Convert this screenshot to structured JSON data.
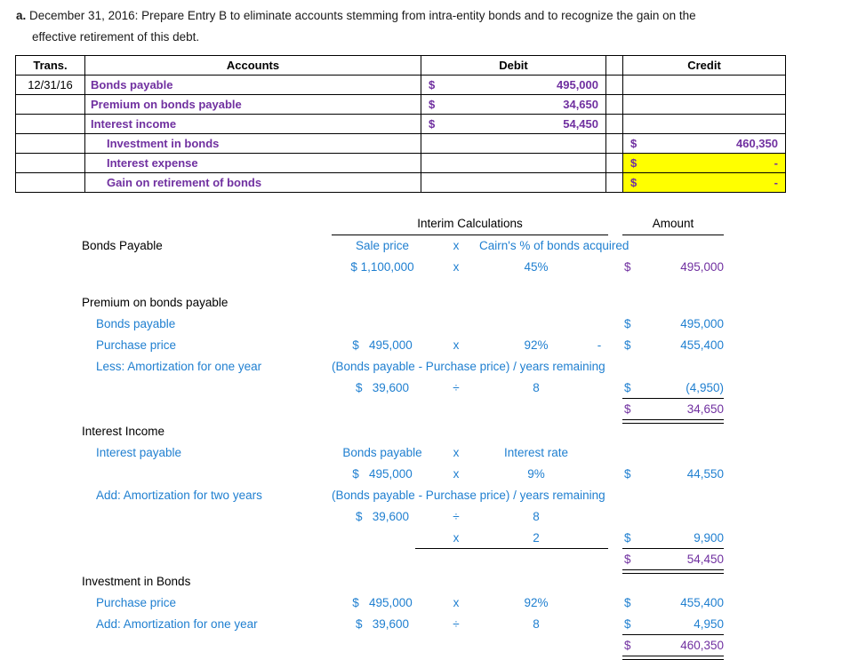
{
  "prompt": {
    "letter": "a.",
    "line1": "December 31, 2016: Prepare Entry B to eliminate accounts stemming from intra-entity bonds and to recognize the gain on the",
    "line2": "effective retirement of this debt."
  },
  "journal_entry": {
    "headers": {
      "trans": "Trans.",
      "accounts": "Accounts",
      "debit": "Debit",
      "credit": "Credit"
    },
    "rows": [
      {
        "trans": "12/31/16",
        "account": "Bonds payable",
        "indent": false,
        "debit_symbol": "$",
        "debit": "495,000",
        "credit_symbol": "",
        "credit": "",
        "highlight": false
      },
      {
        "trans": "",
        "account": "Premium on bonds payable",
        "indent": false,
        "debit_symbol": "$",
        "debit": "34,650",
        "credit_symbol": "",
        "credit": "",
        "highlight": false
      },
      {
        "trans": "",
        "account": "Interest income",
        "indent": false,
        "debit_symbol": "$",
        "debit": "54,450",
        "credit_symbol": "",
        "credit": "",
        "highlight": false
      },
      {
        "trans": "",
        "account": "Investment in bonds",
        "indent": true,
        "debit_symbol": "",
        "debit": "",
        "credit_symbol": "$",
        "credit": "460,350",
        "highlight": false
      },
      {
        "trans": "",
        "account": "Interest expense",
        "indent": true,
        "debit_symbol": "",
        "debit": "",
        "credit_symbol": "$",
        "credit": "-",
        "highlight": true
      },
      {
        "trans": "",
        "account": "Gain on retirement of bonds",
        "indent": true,
        "debit_symbol": "",
        "debit": "",
        "credit_symbol": "$",
        "credit": "-",
        "highlight": true
      }
    ]
  },
  "calc": {
    "headers": {
      "interim": "Interim Calculations",
      "amount": "Amount"
    },
    "sections": [
      {
        "title": "Bonds Payable",
        "formula_header_a": "Sale price",
        "formula_header_op": "x",
        "formula_header_b": "Cairn's % of bonds acquired",
        "value_a": "$ 1,100,000",
        "value_op": "x",
        "value_b": "45%",
        "amount_symbol": "$",
        "amount": "495,000"
      },
      {
        "title": "Premium on bonds payable",
        "line_bonds_payable_label": "Bonds payable",
        "line_bonds_payable_amount_symbol": "$",
        "line_bonds_payable_amount": "495,000",
        "line_purchase_label": "Purchase price",
        "line_purchase_a_symbol": "$",
        "line_purchase_a": "495,000",
        "line_purchase_op": "x",
        "line_purchase_b": "92%",
        "line_purchase_minus": "-",
        "line_purchase_amount_symbol": "$",
        "line_purchase_amount": "455,400",
        "line_amort_label": "Less: Amortization for one year",
        "line_amort_formula": "(Bonds payable - Purchase price) / years remaining",
        "line_amort_a_symbol": "$",
        "line_amort_a": "39,600",
        "line_amort_op": "÷",
        "line_amort_b": "8",
        "line_amort_amount_symbol": "$",
        "line_amort_amount": "(4,950)",
        "total_symbol": "$",
        "total": "34,650"
      },
      {
        "title": "Interest Income",
        "line_payable_label": "Interest payable",
        "formula_header_a": "Bonds payable",
        "formula_header_op": "x",
        "formula_header_b": "Interest rate",
        "value_a_symbol": "$",
        "value_a": "495,000",
        "value_op": "x",
        "value_b": "9%",
        "value_amount_symbol": "$",
        "value_amount": "44,550",
        "line_amort_label": "Add: Amortization for two years",
        "line_amort_formula": "(Bonds payable - Purchase price) / years remaining",
        "line_amort_a_symbol": "$",
        "line_amort_a": "39,600",
        "line_amort_op": "÷",
        "line_amort_b": "8",
        "line_times_op": "x",
        "line_times_b": "2",
        "line_times_amount_symbol": "$",
        "line_times_amount": "9,900",
        "total_symbol": "$",
        "total": "54,450"
      },
      {
        "title": "Investment in Bonds",
        "line_purchase_label": "Purchase price",
        "line_purchase_a_symbol": "$",
        "line_purchase_a": "495,000",
        "line_purchase_op": "x",
        "line_purchase_b": "92%",
        "line_purchase_amount_symbol": "$",
        "line_purchase_amount": "455,400",
        "line_amort_label": "Add: Amortization for one year",
        "line_amort_a_symbol": "$",
        "line_amort_a": "39,600",
        "line_amort_op": "÷",
        "line_amort_b": "8",
        "line_amort_amount_symbol": "$",
        "line_amort_amount": "4,950",
        "total_symbol": "$",
        "total": "460,350"
      }
    ]
  },
  "colors": {
    "purple": "#7030A0",
    "blue": "#1F7FD0",
    "highlight": "#FFFF00"
  }
}
